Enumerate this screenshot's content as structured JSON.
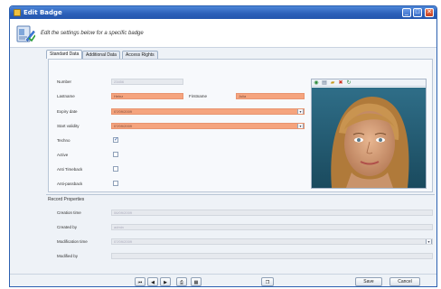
{
  "window": {
    "title": "Edit Badge"
  },
  "header": {
    "instructions": "Edit the settings below for a specific badge"
  },
  "tabs": [
    {
      "label": "Standard Data"
    },
    {
      "label": "Additional Data"
    },
    {
      "label": "Access Rights"
    }
  ],
  "form": {
    "number": {
      "label": "Number",
      "value": "23456"
    },
    "lastname": {
      "label": "Lastname",
      "value": "Heinz"
    },
    "firstname": {
      "label": "Firstname",
      "value": "Julia"
    },
    "expiry_date": {
      "label": "Expiry date",
      "value": "07/09/2009"
    },
    "start_validity": {
      "label": "Start validity",
      "value": "07/09/2009"
    },
    "techno": {
      "label": "Techno",
      "checked": true
    },
    "active": {
      "label": "Active",
      "checked": false
    },
    "anti_timeback": {
      "label": "Anti Timeback",
      "checked": false
    },
    "anti_passback": {
      "label": "Anti-passback",
      "checked": false
    }
  },
  "record": {
    "title": "Record Properties",
    "creation_time": {
      "label": "Creation time",
      "value": "06/09/2009"
    },
    "created_by": {
      "label": "Created by",
      "value": "admin"
    },
    "modification_time": {
      "label": "Modification time",
      "value": "07/09/2009"
    },
    "modified_by": {
      "label": "Modified by",
      "value": ""
    }
  },
  "footer": {
    "save_label": "Save",
    "cancel_label": "Cancel"
  },
  "colors": {
    "required_field": "#f5a47e",
    "titlebar": "#2b5fb8",
    "background": "#eef2f7"
  }
}
